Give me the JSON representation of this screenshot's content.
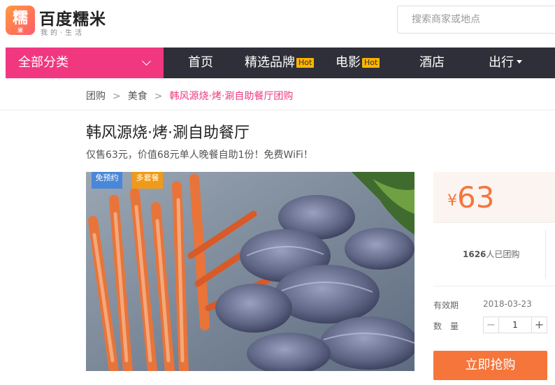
{
  "header": {
    "logo_char": "糯",
    "logo_icon_sub": "米",
    "site_name": "百度糯米",
    "slogan": "我的·生活",
    "search_placeholder": "搜索商家或地点"
  },
  "nav": {
    "all_categories": "全部分类",
    "items": [
      {
        "label": "首页"
      },
      {
        "label": "精选品牌",
        "badge": "Hot"
      },
      {
        "label": "电影",
        "badge": "Hot"
      },
      {
        "label": "酒店"
      },
      {
        "label": "出行"
      }
    ]
  },
  "breadcrumb": {
    "items": [
      "团购",
      "美食",
      "韩风源烧·烤·涮自助餐厅团购"
    ],
    "separator": ">"
  },
  "deal": {
    "title": "韩风源烧·烤·涮自助餐厅",
    "subtitle": "仅售63元，价值68元单人晚餐自助1份！免费WiFi！",
    "image_tags": [
      "免预约",
      "多套餐"
    ],
    "currency": "¥",
    "price": "63",
    "sold_count": "1626",
    "sold_suffix": "人已团购",
    "validity_label": "有效期",
    "validity_value": "2018-03-23",
    "quantity_label": "数　量",
    "quantity_value": "1",
    "minus_symbol": "−",
    "plus_symbol": "+",
    "buy_button": "立即抢购"
  },
  "colors": {
    "brand_pink": "#f0377f",
    "nav_dark": "#2e2f38",
    "hot_badge": "#ffb400",
    "price_orange": "#f5753b",
    "tag_blue": "#4a87d8",
    "tag_orange": "#f09a1a"
  },
  "icons": {
    "all_categories_chevron": "chevron-down-icon",
    "more_caret": "caret-down-icon"
  }
}
